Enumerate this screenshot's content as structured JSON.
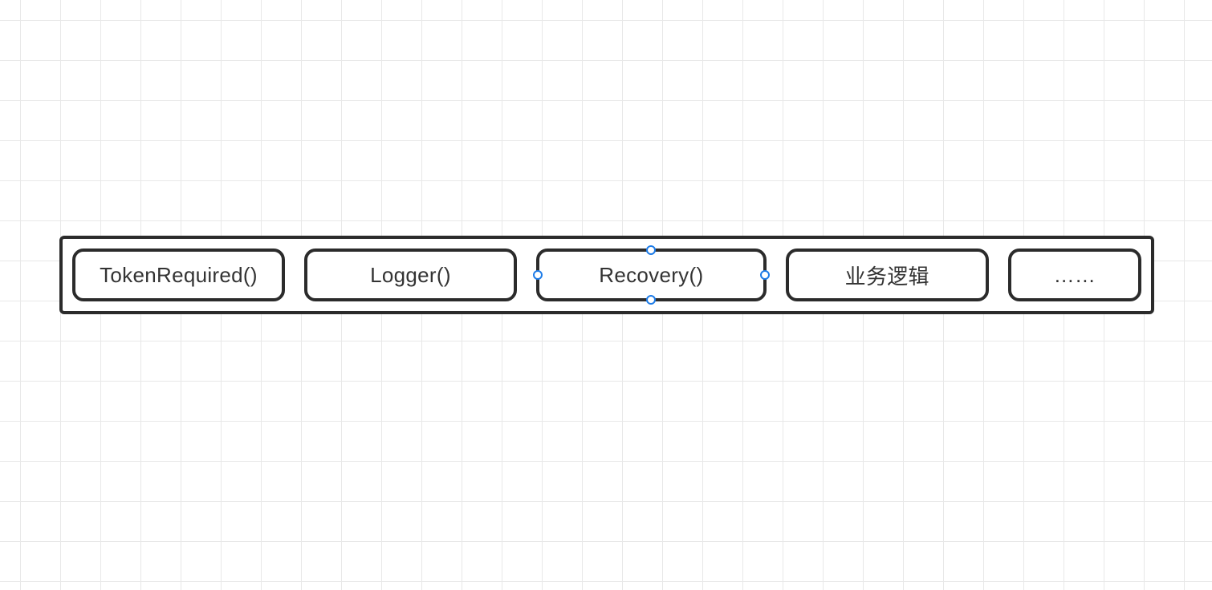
{
  "diagram": {
    "boxes": [
      {
        "label": "TokenRequired()",
        "selected": false
      },
      {
        "label": "Logger()",
        "selected": false
      },
      {
        "label": "Recovery()",
        "selected": true
      },
      {
        "label": "业务逻辑",
        "selected": false
      },
      {
        "label": "……",
        "selected": false
      }
    ]
  },
  "colors": {
    "border": "#2b2b2b",
    "handle_border": "#1e7ce8",
    "grid": "#e8e8e8",
    "text": "#333333"
  }
}
